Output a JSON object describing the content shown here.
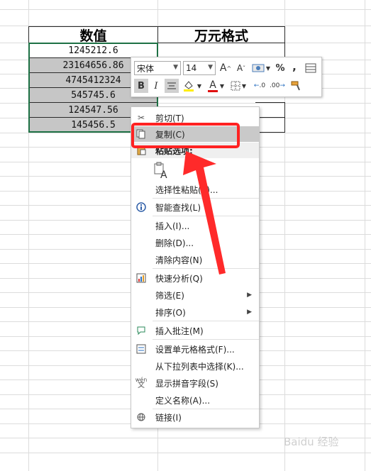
{
  "table": {
    "headers": [
      "数值",
      "万元格式"
    ],
    "values": [
      "1245212.6",
      "23164656.86",
      "4745412324",
      "545745.6",
      "124547.56",
      "145456.5"
    ]
  },
  "minibar": {
    "font_name": "宋体",
    "font_size": "14",
    "bold": "B",
    "italic": "I",
    "percent": "%",
    "comma": ",",
    "font_color_letter": "A",
    "grow_font": "A",
    "shrink_font": "A",
    "inc_decimal": ".00",
    "dec_decimal": ".0"
  },
  "context_menu": {
    "cut": "剪切(T)",
    "copy": "复制(C)",
    "paste_options": "粘贴选项:",
    "paste_special": "选择性粘贴(S)...",
    "smart_lookup": "智能查找(L)",
    "insert": "插入(I)...",
    "delete": "删除(D)...",
    "clear": "清除内容(N)",
    "quick_analysis": "快速分析(Q)",
    "filter": "筛选(E)",
    "sort": "排序(O)",
    "insert_comment": "插入批注(M)",
    "format_cells": "设置单元格格式(F)...",
    "pick_list": "从下拉列表中选择(K)...",
    "phonetic": "显示拼音字段(S)",
    "define_name": "定义名称(A)...",
    "link": "链接(I)"
  },
  "colors": {
    "selection": "#c6c6c6",
    "annotation": "#ff2222",
    "highlight": "#c9c9c9"
  },
  "watermark": "Baidu 经验"
}
